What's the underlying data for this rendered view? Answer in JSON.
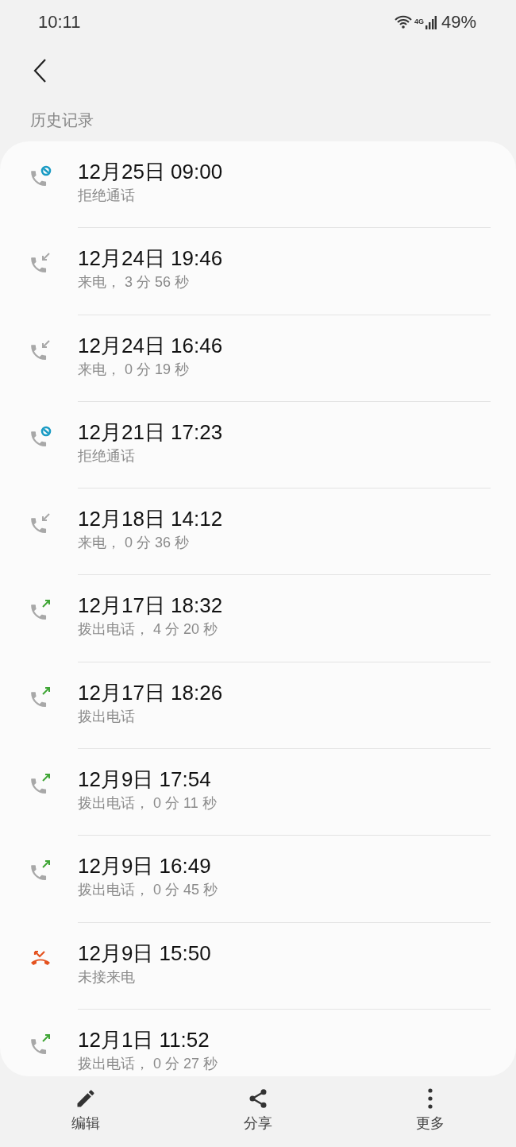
{
  "status_bar": {
    "time": "10:11",
    "network": "4G",
    "battery": "49%"
  },
  "section_title": "历史记录",
  "calls": [
    {
      "kind": "rejected",
      "datetime": "12月25日 09:00",
      "detail": "拒绝通话"
    },
    {
      "kind": "incoming",
      "datetime": "12月24日 19:46",
      "detail": "来电， 3 分 56 秒"
    },
    {
      "kind": "incoming",
      "datetime": "12月24日 16:46",
      "detail": "来电， 0 分 19 秒"
    },
    {
      "kind": "rejected",
      "datetime": "12月21日 17:23",
      "detail": "拒绝通话"
    },
    {
      "kind": "incoming",
      "datetime": "12月18日 14:12",
      "detail": "来电， 0 分 36 秒"
    },
    {
      "kind": "outgoing",
      "datetime": "12月17日 18:32",
      "detail": "拨出电话， 4 分 20 秒"
    },
    {
      "kind": "outgoing",
      "datetime": "12月17日 18:26",
      "detail": "拨出电话"
    },
    {
      "kind": "outgoing",
      "datetime": "12月9日 17:54",
      "detail": "拨出电话， 0 分 11 秒"
    },
    {
      "kind": "outgoing",
      "datetime": "12月9日 16:49",
      "detail": "拨出电话， 0 分 45 秒"
    },
    {
      "kind": "missed",
      "datetime": "12月9日 15:50",
      "detail": "未接来电"
    },
    {
      "kind": "outgoing",
      "datetime": "12月1日 11:52",
      "detail": "拨出电话， 0 分 27 秒"
    }
  ],
  "toolbar": [
    {
      "kind": "edit",
      "label": "编辑"
    },
    {
      "kind": "share",
      "label": "分享"
    },
    {
      "kind": "more",
      "label": "更多"
    }
  ]
}
